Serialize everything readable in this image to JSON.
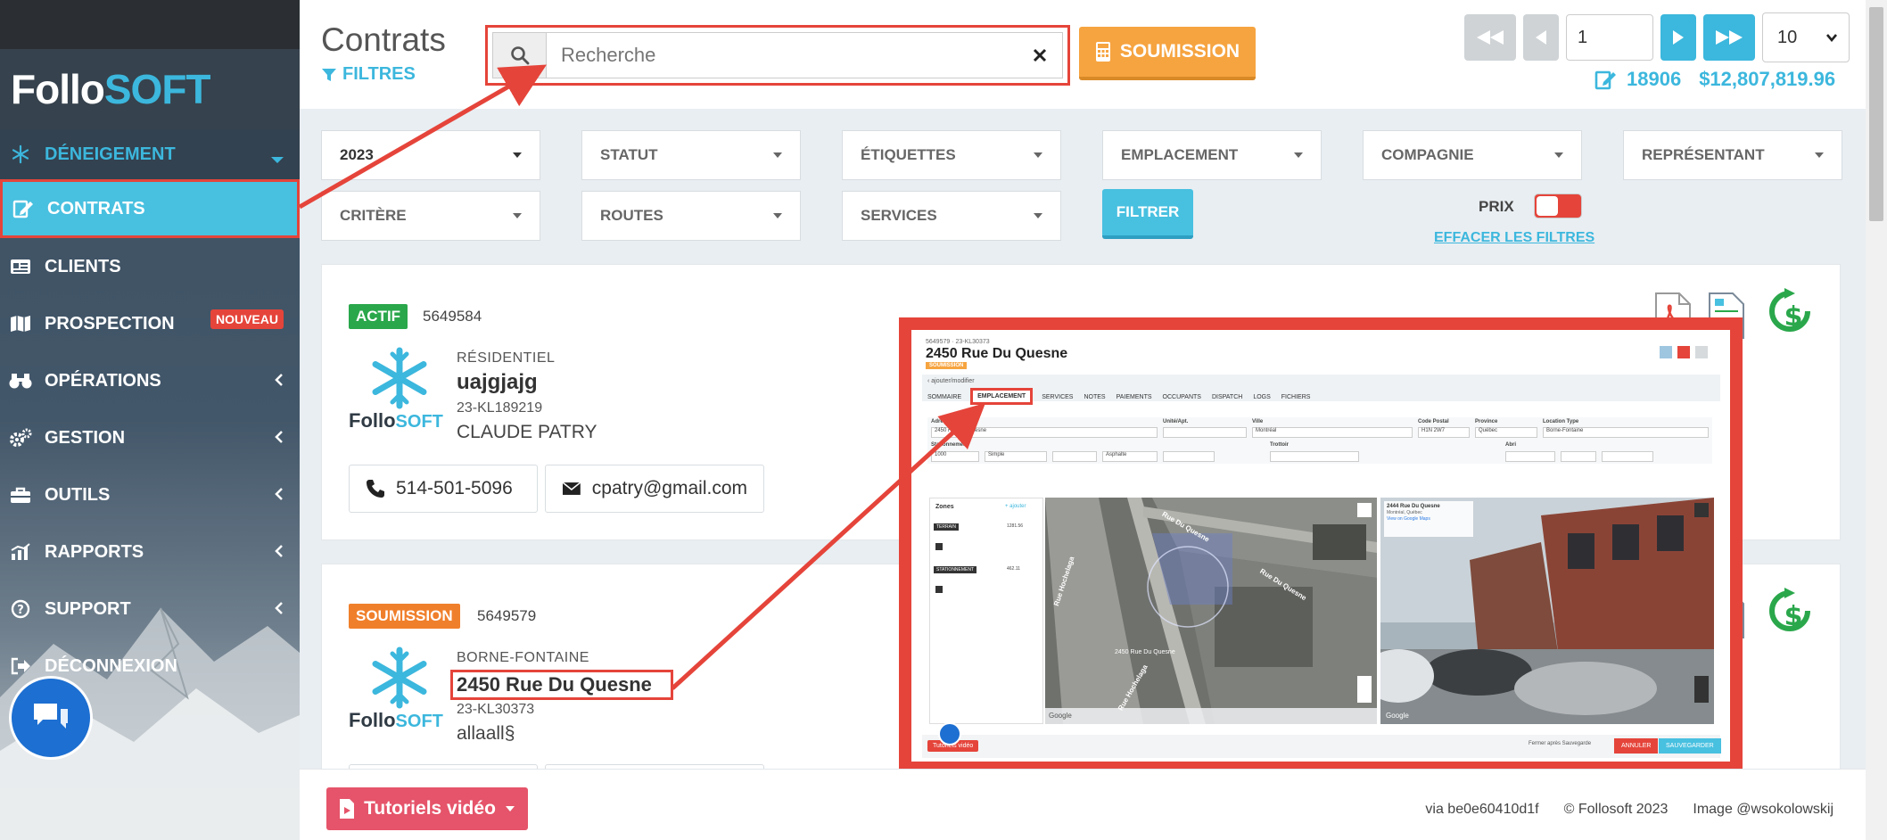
{
  "brand": {
    "follo": "Follo",
    "soft": "SOFT"
  },
  "sidebar": {
    "items": [
      {
        "label": "DÉNEIGEMENT"
      },
      {
        "label": "CONTRATS"
      },
      {
        "label": "CLIENTS"
      },
      {
        "label": "PROSPECTION",
        "badge": "NOUVEAU"
      },
      {
        "label": "OPÉRATIONS"
      },
      {
        "label": "GESTION"
      },
      {
        "label": "OUTILS"
      },
      {
        "label": "RAPPORTS"
      },
      {
        "label": "SUPPORT"
      },
      {
        "label": "DÉCONNEXION"
      }
    ]
  },
  "header": {
    "title": "Contrats",
    "filters_label": "FILTRES",
    "search_placeholder": "Recherche",
    "soumission_label": "SOUMISSION",
    "page_value": "1",
    "per_page": "10",
    "count": "18906",
    "total": "$12,807,819.96"
  },
  "filters": {
    "year": "2023",
    "statut": "STATUT",
    "etiquettes": "ÉTIQUETTES",
    "emplacement": "EMPLACEMENT",
    "compagnie": "COMPAGNIE",
    "representant": "REPRÉSENTANT",
    "critere": "CRITÈRE",
    "routes": "ROUTES",
    "services": "SERVICES",
    "filtrer": "FILTRER",
    "prix": "PRIX",
    "effacer": "EFFACER LES FILTRES"
  },
  "contracts": [
    {
      "status": "ACTIF",
      "number": "5649584",
      "type": "RÉSIDENTIEL",
      "name": "uajgjajg",
      "ref": "23-KL189219",
      "client": "CLAUDE PATRY",
      "phone": "514-501-5096",
      "email": "cpatry@gmail.com"
    },
    {
      "status": "SOUMISSION",
      "number": "5649579",
      "type": "BORNE-FONTAINE",
      "name": "2450 Rue Du Quesne",
      "ref": "23-KL30373",
      "client": "allaall§"
    }
  ],
  "overlay": {
    "ref_top": "5649579 · 23-KL30373",
    "title": "2450 Rue Du Quesne",
    "badge": "SOUMISSION",
    "back": "‹ ajouter/modifier",
    "tabs": [
      "SOMMAIRE",
      "EMPLACEMENT",
      "SERVICES",
      "NOTES",
      "PAIEMENTS",
      "OCCUPANTS",
      "DISPATCH",
      "LOGS",
      "FICHIERS"
    ],
    "labels": {
      "adresse": "Adresse",
      "unite": "Unité/Apt.",
      "ville": "Ville",
      "code_postal": "Code Postal",
      "province": "Province",
      "location_type": "Location Type",
      "stationnement": "Stationnement",
      "trottoir": "Trottoir",
      "abri": "Abri",
      "zones": "Zones",
      "ajouter": "+ ajouter"
    },
    "values": {
      "adresse": "2450 Rue Du Quesne",
      "ville": "Montréal",
      "code_postal": "H1N 2W7",
      "province": "Québec",
      "location_type": "Borne-Fontaine",
      "superficie": "1000",
      "largeur": "Simple",
      "surface": "Asphalte"
    },
    "zones": [
      {
        "tag": "TERRAIN",
        "size": "1281.56"
      },
      {
        "tag": "STATIONNEMENT",
        "size": "462.11"
      }
    ],
    "street_title": "2444 Rue Du Quesne",
    "street_sub": "Montréal, Québec",
    "street_link": "View on Google Maps",
    "map_road_1": "Rue Hochelaga",
    "map_road_2": "Rue Du Quesne",
    "map_road_3": "Rue Hochelaga",
    "map_road_4": "Rue Du Quesne",
    "map_pin": "2450 Rue Du Quesne",
    "google": "Google",
    "tutoriels": "Tutoriels vidéo",
    "keep": "Fermer après Sauvegarde",
    "annuler": "ANNULER",
    "sauvegarder": "SAUVEGARDER"
  },
  "footer": {
    "tutoriels_label": "Tutoriels vidéo",
    "via": "via be0e60410d1f",
    "copyright": "© Follosoft 2023",
    "image_credit": "Image @wsokolowskij"
  },
  "colors": {
    "accent": "#48c0e0",
    "warning": "#f6a440",
    "danger": "#e5443a",
    "success": "#2aa74b"
  }
}
